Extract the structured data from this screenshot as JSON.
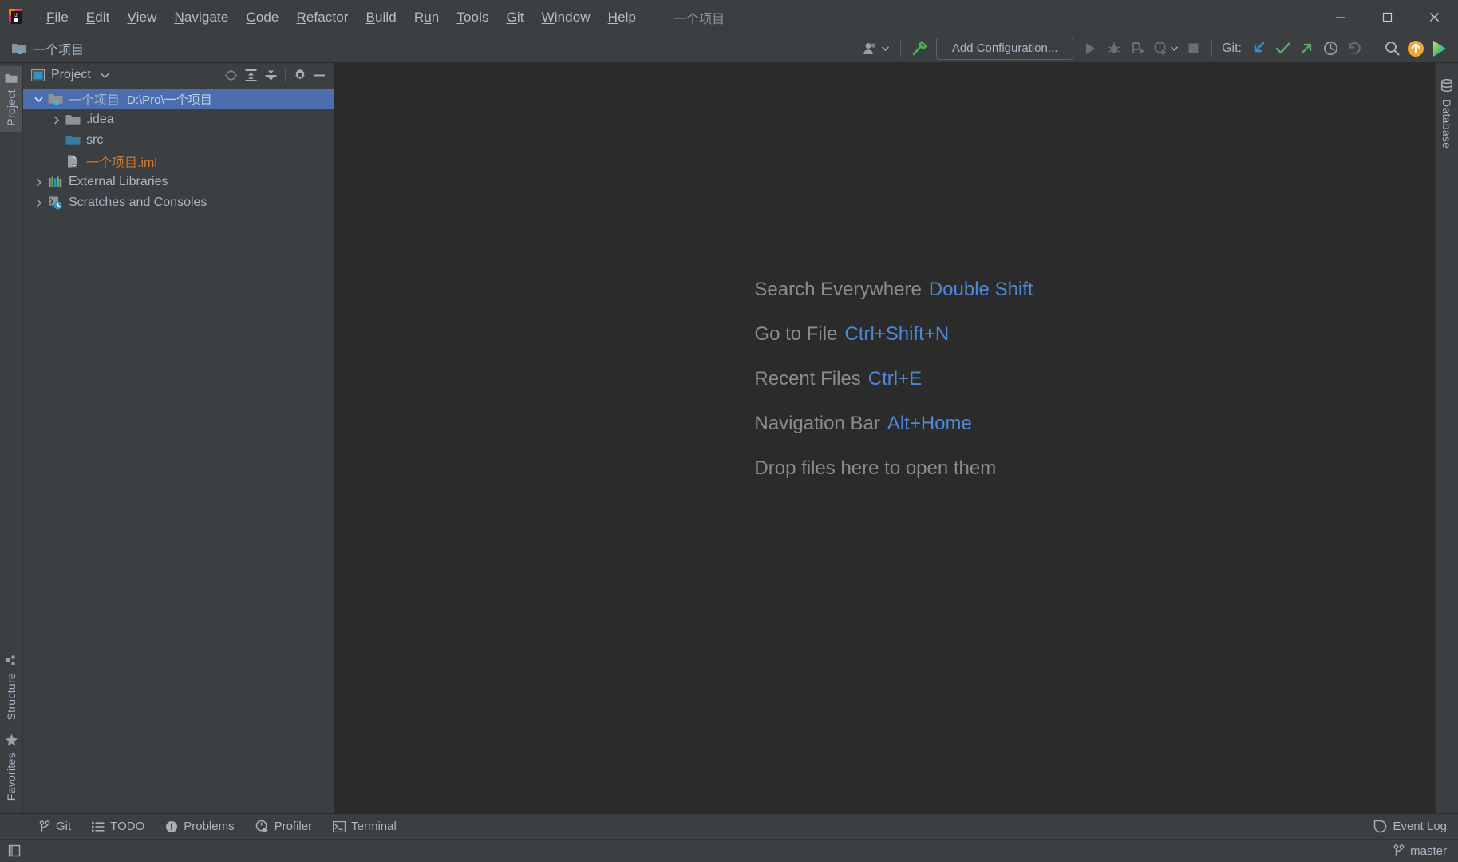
{
  "window": {
    "title": "一个项目",
    "controls": [
      {
        "name": "minimize-button",
        "glyph": "minimize"
      },
      {
        "name": "maximize-button",
        "glyph": "maximize"
      },
      {
        "name": "close-button",
        "glyph": "close"
      }
    ]
  },
  "menubar": {
    "logo_name": "intellij-idea-logo",
    "items": [
      {
        "label": "File",
        "mnemonic": "F"
      },
      {
        "label": "Edit",
        "mnemonic": "E"
      },
      {
        "label": "View",
        "mnemonic": "V"
      },
      {
        "label": "Navigate",
        "mnemonic": "N"
      },
      {
        "label": "Code",
        "mnemonic": "C"
      },
      {
        "label": "Refactor",
        "mnemonic": "R"
      },
      {
        "label": "Build",
        "mnemonic": "B"
      },
      {
        "label": "Run",
        "mnemonic": "u"
      },
      {
        "label": "Tools",
        "mnemonic": "T"
      },
      {
        "label": "Git",
        "mnemonic": "G"
      },
      {
        "label": "Window",
        "mnemonic": "W"
      },
      {
        "label": "Help",
        "mnemonic": "H"
      }
    ]
  },
  "toolbar": {
    "project_name": "一个项目",
    "project_icon": "project-folder-icon",
    "user_icon": "user-account-icon",
    "build_icon": "build-hammer-icon",
    "run_config": "Add Configuration...",
    "run_icon": "run-icon",
    "debug_icon": "debug-icon",
    "run_coverage_icon": "run-with-coverage-icon",
    "profile_icon": "profile-icon",
    "stop_icon": "stop-icon",
    "git_label": "Git:",
    "git_update_icon": "git-update-icon",
    "git_commit_icon": "git-commit-icon",
    "git_push_icon": "git-push-icon",
    "git_history_icon": "git-history-icon",
    "git_rollback_icon": "git-rollback-icon",
    "search_icon": "search-everywhere-icon",
    "update_badge_icon": "ide-update-icon",
    "feature_icon": "feature-trainer-icon"
  },
  "left_stripe": {
    "tabs": [
      {
        "label": "Project",
        "icon": "project-icon",
        "active": true
      },
      {
        "label": "Structure",
        "icon": "structure-icon",
        "active": false
      },
      {
        "label": "Favorites",
        "icon": "favorites-star-icon",
        "active": false
      }
    ]
  },
  "right_stripe": {
    "tabs": [
      {
        "label": "Database",
        "icon": "database-icon",
        "active": false
      }
    ]
  },
  "project_panel": {
    "title": "Project",
    "view_icon": "project-view-icon",
    "dropdown_icon": "chevron-down-icon",
    "actions": [
      {
        "name": "select-opened-file-button",
        "icon": "locate-target-icon"
      },
      {
        "name": "expand-all-button",
        "icon": "expand-all-icon"
      },
      {
        "name": "collapse-all-button",
        "icon": "collapse-all-icon"
      },
      {
        "name": "settings-button",
        "icon": "gear-icon"
      },
      {
        "name": "hide-panel-button",
        "icon": "minimize-icon"
      }
    ],
    "tree": [
      {
        "label": "一个项目",
        "path": "D:\\Pro\\一个项目",
        "icon": "project-root-folder-icon",
        "indent": 0,
        "arrow": "expanded",
        "selected": true,
        "style": "normal"
      },
      {
        "label": ".idea",
        "path": "",
        "icon": "folder-icon",
        "indent": 1,
        "arrow": "collapsed",
        "selected": false,
        "style": "normal"
      },
      {
        "label": "src",
        "path": "",
        "icon": "source-folder-icon",
        "indent": 1,
        "arrow": "none",
        "selected": false,
        "style": "normal"
      },
      {
        "label": "一个项目.iml",
        "path": "",
        "icon": "iml-file-icon",
        "indent": 1,
        "arrow": "none",
        "selected": false,
        "style": "iml"
      },
      {
        "label": "External Libraries",
        "path": "",
        "icon": "external-libraries-icon",
        "indent": 0,
        "arrow": "collapsed",
        "selected": false,
        "style": "normal"
      },
      {
        "label": "Scratches and Consoles",
        "path": "",
        "icon": "scratches-icon",
        "indent": 0,
        "arrow": "collapsed",
        "selected": false,
        "style": "normal"
      }
    ]
  },
  "welcome": {
    "lines": [
      {
        "label": "Search Everywhere",
        "shortcut": "Double Shift"
      },
      {
        "label": "Go to File",
        "shortcut": "Ctrl+Shift+N"
      },
      {
        "label": "Recent Files",
        "shortcut": "Ctrl+E"
      },
      {
        "label": "Navigation Bar",
        "shortcut": "Alt+Home"
      },
      {
        "label": "Drop files here to open them",
        "shortcut": ""
      }
    ]
  },
  "tool_window_bar": {
    "items": [
      {
        "label": "Git",
        "icon": "git-branch-icon"
      },
      {
        "label": "TODO",
        "icon": "todo-list-icon"
      },
      {
        "label": "Problems",
        "icon": "problems-icon"
      },
      {
        "label": "Profiler",
        "icon": "profiler-icon"
      },
      {
        "label": "Terminal",
        "icon": "terminal-icon"
      }
    ],
    "event_log": {
      "label": "Event Log",
      "icon": "event-log-icon"
    }
  },
  "statusbar": {
    "layout_icon": "toggle-toolwindows-icon",
    "branch": "master",
    "branch_icon": "git-branch-icon"
  },
  "colors": {
    "accent_blue": "#4d88d9",
    "selection_blue": "#4b6eaf",
    "panel_bg": "#3c3f41",
    "editor_bg": "#2b2b2b",
    "text": "#a9b7c6",
    "iml_orange": "#cc7832",
    "green": "#59a869",
    "folder_gray": "#8d9399",
    "source_teal": "#3b7a9e"
  }
}
